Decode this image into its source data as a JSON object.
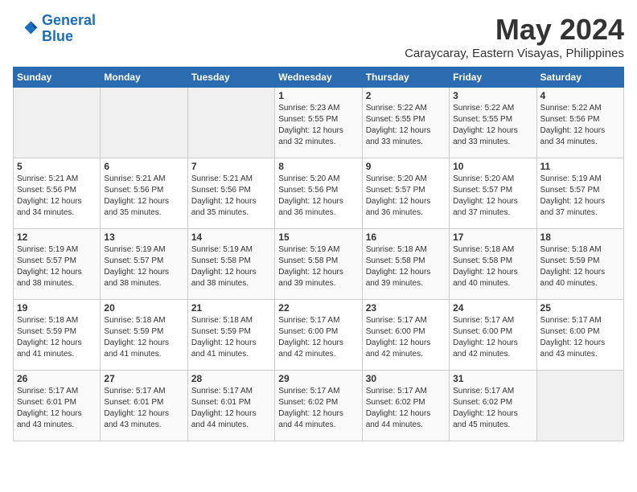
{
  "header": {
    "logo_line1": "General",
    "logo_line2": "Blue",
    "month": "May 2024",
    "location": "Caraycaray, Eastern Visayas, Philippines"
  },
  "weekdays": [
    "Sunday",
    "Monday",
    "Tuesday",
    "Wednesday",
    "Thursday",
    "Friday",
    "Saturday"
  ],
  "weeks": [
    [
      {
        "day": "",
        "content": ""
      },
      {
        "day": "",
        "content": ""
      },
      {
        "day": "",
        "content": ""
      },
      {
        "day": "1",
        "content": "Sunrise: 5:23 AM\nSunset: 5:55 PM\nDaylight: 12 hours\nand 32 minutes."
      },
      {
        "day": "2",
        "content": "Sunrise: 5:22 AM\nSunset: 5:55 PM\nDaylight: 12 hours\nand 33 minutes."
      },
      {
        "day": "3",
        "content": "Sunrise: 5:22 AM\nSunset: 5:55 PM\nDaylight: 12 hours\nand 33 minutes."
      },
      {
        "day": "4",
        "content": "Sunrise: 5:22 AM\nSunset: 5:56 PM\nDaylight: 12 hours\nand 34 minutes."
      }
    ],
    [
      {
        "day": "5",
        "content": "Sunrise: 5:21 AM\nSunset: 5:56 PM\nDaylight: 12 hours\nand 34 minutes."
      },
      {
        "day": "6",
        "content": "Sunrise: 5:21 AM\nSunset: 5:56 PM\nDaylight: 12 hours\nand 35 minutes."
      },
      {
        "day": "7",
        "content": "Sunrise: 5:21 AM\nSunset: 5:56 PM\nDaylight: 12 hours\nand 35 minutes."
      },
      {
        "day": "8",
        "content": "Sunrise: 5:20 AM\nSunset: 5:56 PM\nDaylight: 12 hours\nand 36 minutes."
      },
      {
        "day": "9",
        "content": "Sunrise: 5:20 AM\nSunset: 5:57 PM\nDaylight: 12 hours\nand 36 minutes."
      },
      {
        "day": "10",
        "content": "Sunrise: 5:20 AM\nSunset: 5:57 PM\nDaylight: 12 hours\nand 37 minutes."
      },
      {
        "day": "11",
        "content": "Sunrise: 5:19 AM\nSunset: 5:57 PM\nDaylight: 12 hours\nand 37 minutes."
      }
    ],
    [
      {
        "day": "12",
        "content": "Sunrise: 5:19 AM\nSunset: 5:57 PM\nDaylight: 12 hours\nand 38 minutes."
      },
      {
        "day": "13",
        "content": "Sunrise: 5:19 AM\nSunset: 5:57 PM\nDaylight: 12 hours\nand 38 minutes."
      },
      {
        "day": "14",
        "content": "Sunrise: 5:19 AM\nSunset: 5:58 PM\nDaylight: 12 hours\nand 38 minutes."
      },
      {
        "day": "15",
        "content": "Sunrise: 5:19 AM\nSunset: 5:58 PM\nDaylight: 12 hours\nand 39 minutes."
      },
      {
        "day": "16",
        "content": "Sunrise: 5:18 AM\nSunset: 5:58 PM\nDaylight: 12 hours\nand 39 minutes."
      },
      {
        "day": "17",
        "content": "Sunrise: 5:18 AM\nSunset: 5:58 PM\nDaylight: 12 hours\nand 40 minutes."
      },
      {
        "day": "18",
        "content": "Sunrise: 5:18 AM\nSunset: 5:59 PM\nDaylight: 12 hours\nand 40 minutes."
      }
    ],
    [
      {
        "day": "19",
        "content": "Sunrise: 5:18 AM\nSunset: 5:59 PM\nDaylight: 12 hours\nand 41 minutes."
      },
      {
        "day": "20",
        "content": "Sunrise: 5:18 AM\nSunset: 5:59 PM\nDaylight: 12 hours\nand 41 minutes."
      },
      {
        "day": "21",
        "content": "Sunrise: 5:18 AM\nSunset: 5:59 PM\nDaylight: 12 hours\nand 41 minutes."
      },
      {
        "day": "22",
        "content": "Sunrise: 5:17 AM\nSunset: 6:00 PM\nDaylight: 12 hours\nand 42 minutes."
      },
      {
        "day": "23",
        "content": "Sunrise: 5:17 AM\nSunset: 6:00 PM\nDaylight: 12 hours\nand 42 minutes."
      },
      {
        "day": "24",
        "content": "Sunrise: 5:17 AM\nSunset: 6:00 PM\nDaylight: 12 hours\nand 42 minutes."
      },
      {
        "day": "25",
        "content": "Sunrise: 5:17 AM\nSunset: 6:00 PM\nDaylight: 12 hours\nand 43 minutes."
      }
    ],
    [
      {
        "day": "26",
        "content": "Sunrise: 5:17 AM\nSunset: 6:01 PM\nDaylight: 12 hours\nand 43 minutes."
      },
      {
        "day": "27",
        "content": "Sunrise: 5:17 AM\nSunset: 6:01 PM\nDaylight: 12 hours\nand 43 minutes."
      },
      {
        "day": "28",
        "content": "Sunrise: 5:17 AM\nSunset: 6:01 PM\nDaylight: 12 hours\nand 44 minutes."
      },
      {
        "day": "29",
        "content": "Sunrise: 5:17 AM\nSunset: 6:02 PM\nDaylight: 12 hours\nand 44 minutes."
      },
      {
        "day": "30",
        "content": "Sunrise: 5:17 AM\nSunset: 6:02 PM\nDaylight: 12 hours\nand 44 minutes."
      },
      {
        "day": "31",
        "content": "Sunrise: 5:17 AM\nSunset: 6:02 PM\nDaylight: 12 hours\nand 45 minutes."
      },
      {
        "day": "",
        "content": ""
      }
    ]
  ]
}
